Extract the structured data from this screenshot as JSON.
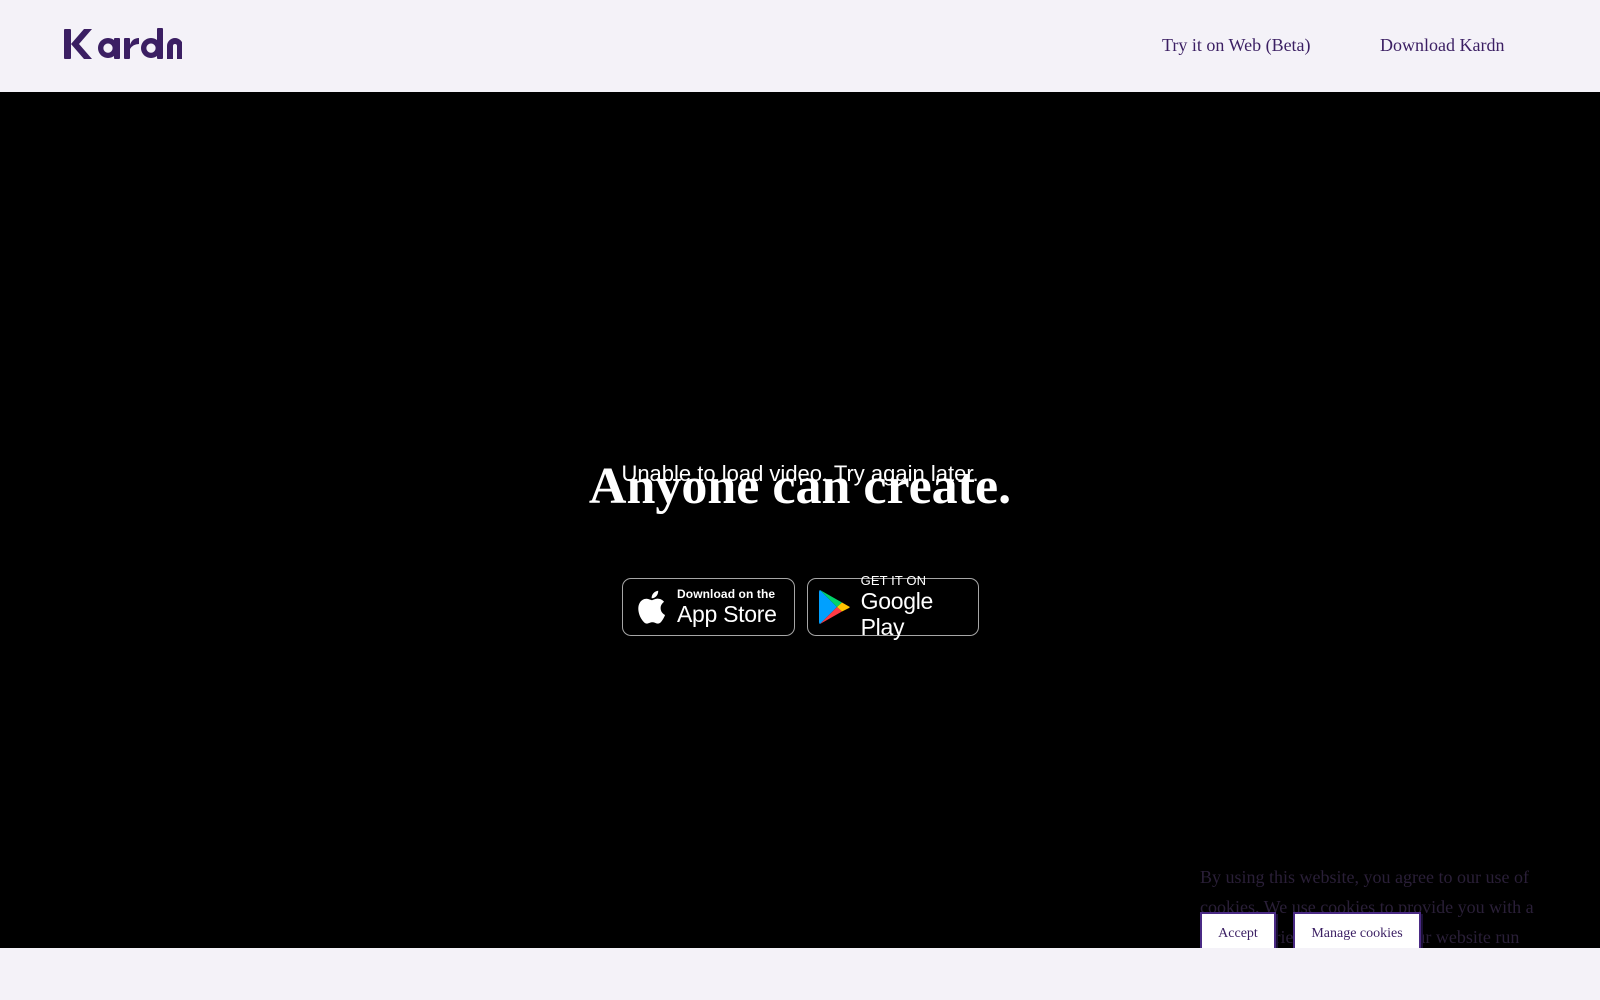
{
  "header": {
    "logo_text": "Kardn",
    "nav_web": "Try it on Web (Beta)",
    "nav_download": "Download Kardn"
  },
  "hero": {
    "video_error": "Unable to load video. Try again later.",
    "headline": "Anyone can create."
  },
  "badges": {
    "apple_small": "Download on the",
    "apple_big": "App Store",
    "google_small": "GET IT ON",
    "google_big": "Google Play"
  },
  "cookie": {
    "text": "By using this website, you agree to our use of cookies. We use cookies to provide you with a great experience and to help our website run effectively.",
    "accept": "Accept",
    "manage": "Manage cookies"
  },
  "colors": {
    "brand": "#3b1f63",
    "hero_bg": "#000000",
    "page_bg": "#f4f2f8"
  },
  "icons": [
    "kardn-logo",
    "apple-icon",
    "google-play-icon"
  ]
}
